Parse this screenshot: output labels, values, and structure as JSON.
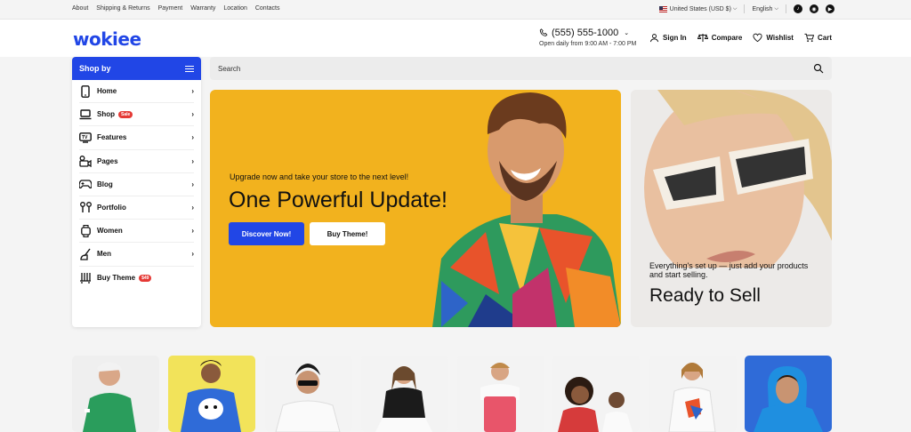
{
  "topbar": {
    "links": [
      "About",
      "Shipping & Returns",
      "Payment",
      "Warranty",
      "Location",
      "Contacts"
    ],
    "currency": "United States (USD $)",
    "language": "English"
  },
  "header": {
    "logo": "wokiee",
    "phone": "(555) 555-1000",
    "hours": "Open daily from 9:00 AM - 7:00 PM",
    "nav": {
      "signin": "Sign In",
      "compare": "Compare",
      "wishlist": "Wishlist",
      "cart": "Cart"
    }
  },
  "sidebar": {
    "title": "Shop by",
    "items": [
      {
        "label": "Home",
        "icon": "phone-icon"
      },
      {
        "label": "Shop",
        "icon": "laptop-icon",
        "badge": "Sale"
      },
      {
        "label": "Features",
        "icon": "tv-icon"
      },
      {
        "label": "Pages",
        "icon": "camera-icon"
      },
      {
        "label": "Blog",
        "icon": "gamepad-icon"
      },
      {
        "label": "Portfolio",
        "icon": "earbuds-icon"
      },
      {
        "label": "Women",
        "icon": "watch-icon"
      },
      {
        "label": "Men",
        "icon": "vacuum-icon"
      },
      {
        "label": "Buy Theme",
        "icon": "heater-icon",
        "badge": "$49"
      }
    ]
  },
  "search": {
    "placeholder": "Search"
  },
  "hero": {
    "subtitle": "Upgrade now and take your store to the next level!",
    "title": "One Powerful Update!",
    "primary_button": "Discover Now!",
    "secondary_button": "Buy Theme!",
    "background": "#f2b21e"
  },
  "banner2": {
    "text": "Everything's set up — just add your products and start selling.",
    "title": "Ready to Sell"
  },
  "colors": {
    "accent": "#2146e6",
    "badge": "#e53935"
  }
}
